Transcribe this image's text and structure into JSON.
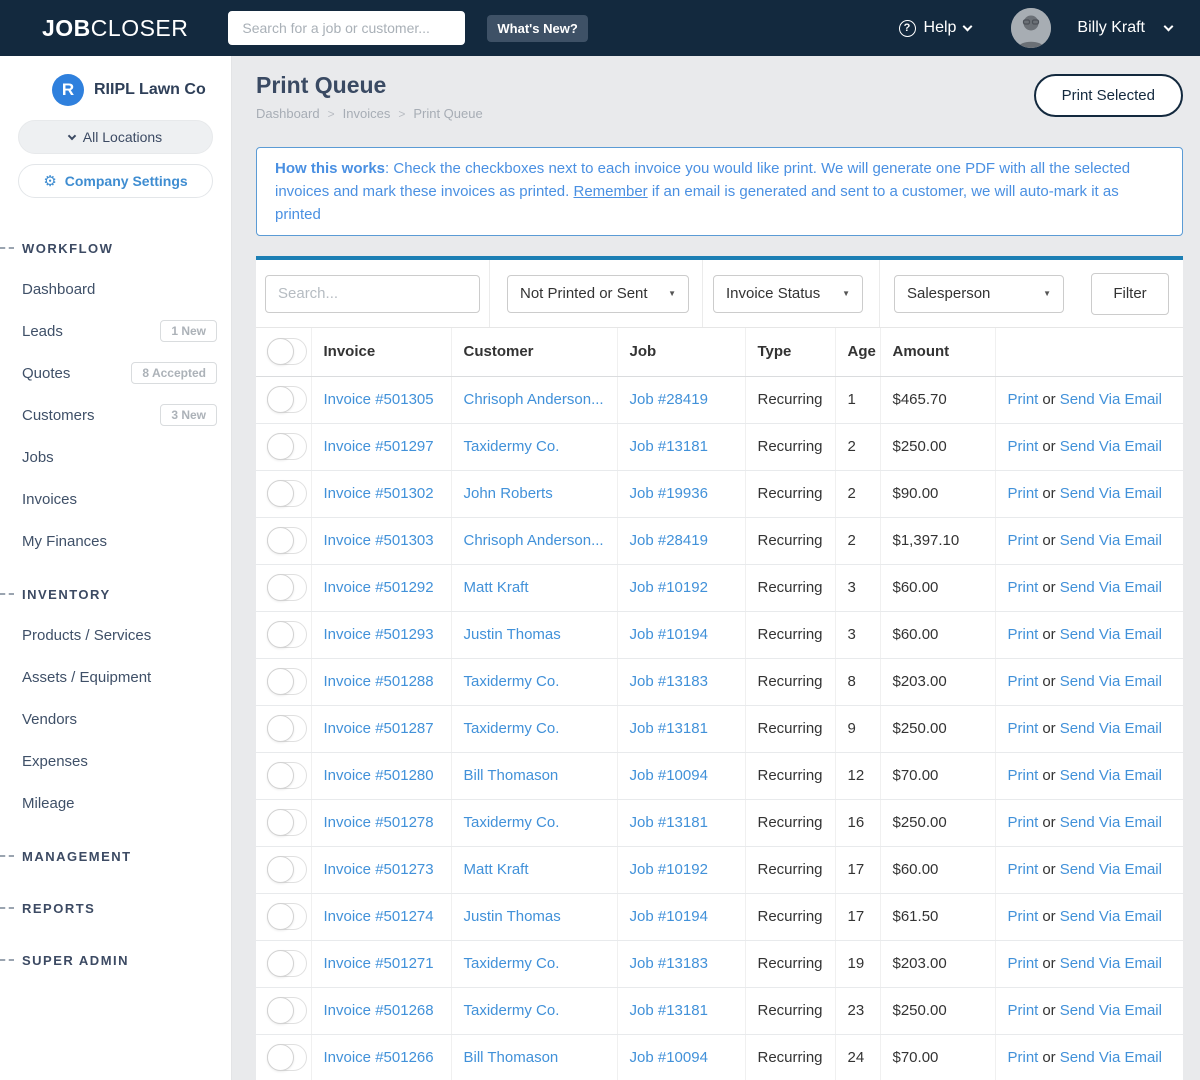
{
  "navbar": {
    "logo_bold": "JOB",
    "logo_light": "CLOSER",
    "search_placeholder": "Search for a job or customer...",
    "whats_new_label": "What's New?",
    "help_label": "Help",
    "user_name": "Billy Kraft"
  },
  "icons": {
    "help_glyph": "?",
    "gear_glyph": "⚙"
  },
  "sidebar": {
    "company_initial": "R",
    "company_name": "RIIPL Lawn Co",
    "locations_label": "All Locations",
    "company_settings_label": "Company Settings",
    "sections": [
      {
        "header": "WORKFLOW",
        "items": [
          {
            "label": "Dashboard"
          },
          {
            "label": "Leads",
            "badge": "1 New"
          },
          {
            "label": "Quotes",
            "badge": "8 Accepted"
          },
          {
            "label": "Customers",
            "badge": "3 New"
          },
          {
            "label": "Jobs"
          },
          {
            "label": "Invoices"
          },
          {
            "label": "My Finances"
          }
        ]
      },
      {
        "header": "INVENTORY",
        "items": [
          {
            "label": "Products / Services"
          },
          {
            "label": "Assets / Equipment"
          },
          {
            "label": "Vendors"
          },
          {
            "label": "Expenses"
          },
          {
            "label": "Mileage"
          }
        ]
      },
      {
        "header": "MANAGEMENT",
        "items": []
      },
      {
        "header": "REPORTS",
        "items": []
      },
      {
        "header": "SUPER ADMIN",
        "items": []
      }
    ]
  },
  "main": {
    "title": "Print Queue",
    "breadcrumb": [
      "Dashboard",
      "Invoices",
      "Print Queue"
    ],
    "breadcrumb_separator": ">",
    "print_selected_label": "Print Selected",
    "info": {
      "bold": "How this works",
      "text_1": ": Check the checkboxes next to each invoice you would like print. We will generate one PDF with all the selected invoices and mark these invoices as printed. ",
      "underline": "Remember",
      "text_2": " if an email is generated and sent to a customer, we will auto-mark it as printed"
    },
    "filters": {
      "search_placeholder": "Search...",
      "dropdowns": [
        "Not Printed or Sent",
        "Invoice Status",
        "Salesperson"
      ],
      "filter_button_label": "Filter"
    },
    "table": {
      "columns": [
        "Invoice",
        "Customer",
        "Job",
        "Type",
        "Age",
        "Amount"
      ],
      "action_print": "Print",
      "action_or": "or",
      "action_email": "Send Via Email",
      "rows": [
        {
          "invoice": "Invoice #501305",
          "customer": "Chrisoph Anderson...",
          "job": "Job #28419",
          "type": "Recurring",
          "age": "1",
          "amount": "$465.70"
        },
        {
          "invoice": "Invoice #501297",
          "customer": "Taxidermy Co.",
          "job": "Job #13181",
          "type": "Recurring",
          "age": "2",
          "amount": "$250.00"
        },
        {
          "invoice": "Invoice #501302",
          "customer": "John Roberts",
          "job": "Job #19936",
          "type": "Recurring",
          "age": "2",
          "amount": "$90.00"
        },
        {
          "invoice": "Invoice #501303",
          "customer": "Chrisoph Anderson...",
          "job": "Job #28419",
          "type": "Recurring",
          "age": "2",
          "amount": "$1,397.10"
        },
        {
          "invoice": "Invoice #501292",
          "customer": "Matt Kraft",
          "job": "Job #10192",
          "type": "Recurring",
          "age": "3",
          "amount": "$60.00"
        },
        {
          "invoice": "Invoice #501293",
          "customer": "Justin Thomas",
          "job": "Job #10194",
          "type": "Recurring",
          "age": "3",
          "amount": "$60.00"
        },
        {
          "invoice": "Invoice #501288",
          "customer": "Taxidermy Co.",
          "job": "Job #13183",
          "type": "Recurring",
          "age": "8",
          "amount": "$203.00"
        },
        {
          "invoice": "Invoice #501287",
          "customer": "Taxidermy Co.",
          "job": "Job #13181",
          "type": "Recurring",
          "age": "9",
          "amount": "$250.00"
        },
        {
          "invoice": "Invoice #501280",
          "customer": "Bill Thomason",
          "job": "Job #10094",
          "type": "Recurring",
          "age": "12",
          "amount": "$70.00"
        },
        {
          "invoice": "Invoice #501278",
          "customer": "Taxidermy Co.",
          "job": "Job #13181",
          "type": "Recurring",
          "age": "16",
          "amount": "$250.00"
        },
        {
          "invoice": "Invoice #501273",
          "customer": "Matt Kraft",
          "job": "Job #10192",
          "type": "Recurring",
          "age": "17",
          "amount": "$60.00"
        },
        {
          "invoice": "Invoice #501274",
          "customer": "Justin Thomas",
          "job": "Job #10194",
          "type": "Recurring",
          "age": "17",
          "amount": "$61.50"
        },
        {
          "invoice": "Invoice #501271",
          "customer": "Taxidermy Co.",
          "job": "Job #13183",
          "type": "Recurring",
          "age": "19",
          "amount": "$203.00"
        },
        {
          "invoice": "Invoice #501268",
          "customer": "Taxidermy Co.",
          "job": "Job #13181",
          "type": "Recurring",
          "age": "23",
          "amount": "$250.00"
        },
        {
          "invoice": "Invoice #501266",
          "customer": "Bill Thomason",
          "job": "Job #10094",
          "type": "Recurring",
          "age": "24",
          "amount": "$70.00"
        }
      ]
    }
  },
  "colors": {
    "navbar_bg": "#13293e",
    "accent_link_blue": "#4191d9",
    "info_text_blue": "#4a90e2",
    "card_top_border": "#1c7fb4",
    "brand_logo_circle": "#2f80dd"
  }
}
